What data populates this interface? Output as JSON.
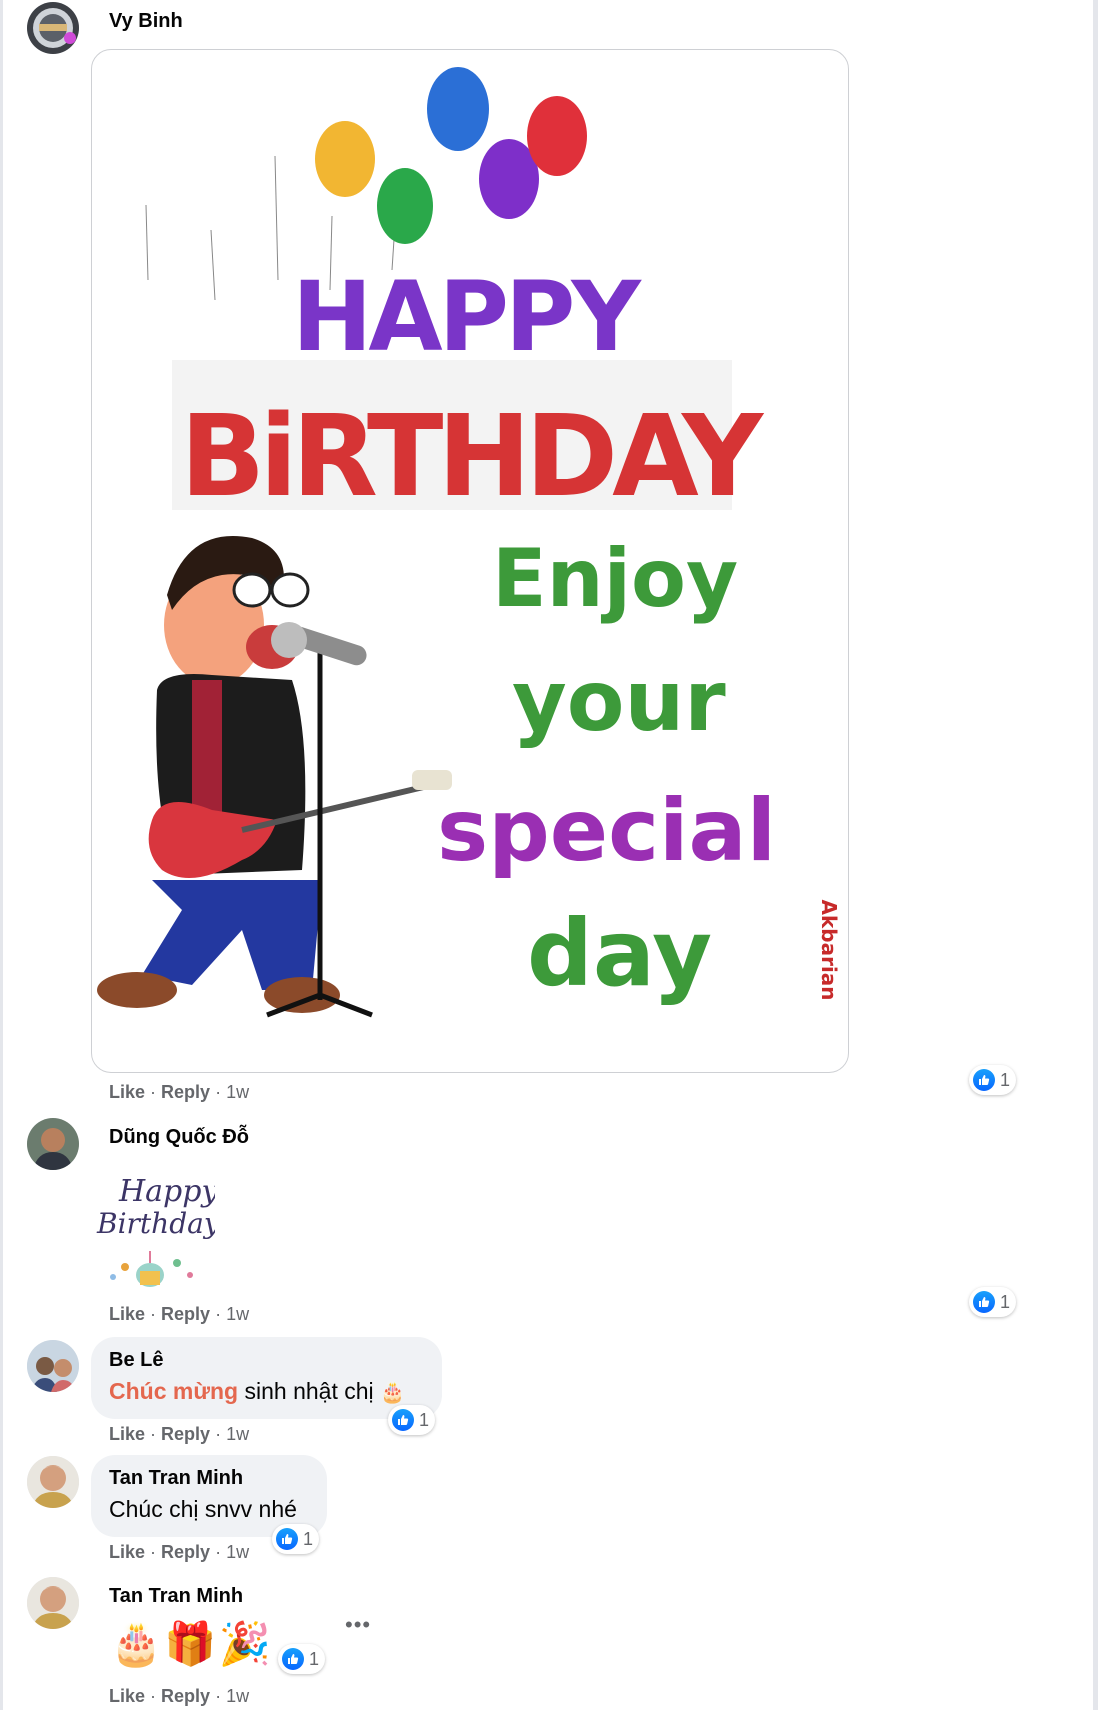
{
  "comments": [
    {
      "author": "Vy Binh",
      "gif_text": {
        "happy": "HAPPY",
        "birthday": "BiRTHDAY",
        "enjoy": "Enjoy",
        "your": "your",
        "special": "special",
        "day": "day",
        "watermark": "Akbarian"
      },
      "actions": {
        "like": "Like",
        "reply": "Reply",
        "time": "1w"
      },
      "reactions": "1"
    },
    {
      "author": "Dũng Quốc Đỗ",
      "sticker_text": {
        "line1": "Happy",
        "line2": "Birthday"
      },
      "actions": {
        "like": "Like",
        "reply": "Reply",
        "time": "1w"
      },
      "reactions": "1"
    },
    {
      "author": "Be Lê",
      "tag": "Chúc mừng",
      "text": " sinh nhật chị ",
      "emoji": "🎂",
      "actions": {
        "like": "Like",
        "reply": "Reply",
        "time": "1w"
      },
      "reactions": "1"
    },
    {
      "author": "Tan Tran Minh",
      "text": "Chúc chị snvv nhé",
      "actions": {
        "like": "Like",
        "reply": "Reply",
        "time": "1w"
      },
      "reactions": "1"
    },
    {
      "author": "Tan Tran Minh",
      "emojis": [
        "🎂",
        "🎁",
        "🎉"
      ],
      "actions": {
        "like": "Like",
        "reply": "Reply",
        "time": "1w"
      },
      "reactions": "1"
    }
  ],
  "icons": {
    "reaction": "like-icon",
    "more": "more-options-icon"
  },
  "colors": {
    "like_blue": "#0866ff",
    "tag_orange": "#e4674e",
    "muted": "#65676b"
  }
}
